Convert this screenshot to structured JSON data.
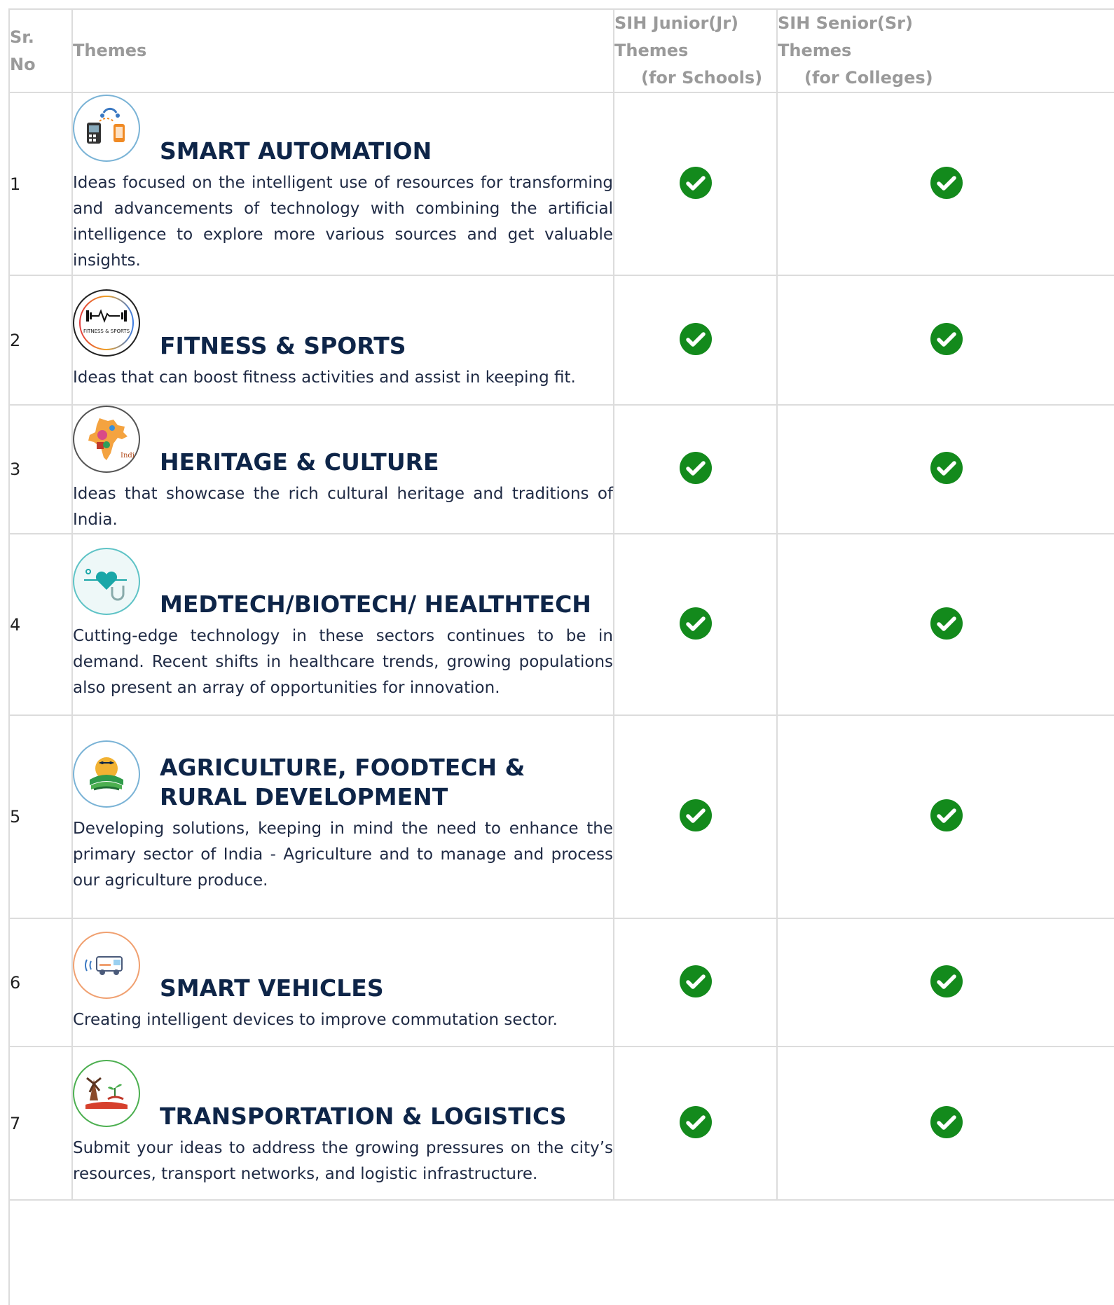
{
  "table": {
    "headers": {
      "sr": [
        "Sr.",
        "No"
      ],
      "themes": "Themes",
      "junior": [
        "SIH Junior(Jr)",
        "Themes",
        "(for Schools)"
      ],
      "senior": [
        "SIH Senior(Sr)",
        "Themes",
        "(for Colleges)"
      ]
    },
    "rows": [
      {
        "sr": "1",
        "title": "SMART AUTOMATION",
        "icon": "smart-automation-logo-icon",
        "desc": "Ideas focused on the intelligent use of resources for transforming and advancements of technology with combining the artificial intelligence to explore more various sources and get valuable insights.",
        "junior": true,
        "senior": true
      },
      {
        "sr": "2",
        "title": "FITNESS & SPORTS",
        "icon": "fitness-sports-logo-icon",
        "logo_text": "FITNESS & SPORTS",
        "desc": "Ideas that can boost fitness activities and assist in keeping fit.",
        "junior": true,
        "senior": true
      },
      {
        "sr": "3",
        "title": "HERITAGE & CULTURE",
        "icon": "heritage-culture-logo-icon",
        "logo_text": "India",
        "desc": "Ideas that showcase the rich cultural heritage and traditions of India.",
        "junior": true,
        "senior": true
      },
      {
        "sr": "4",
        "title": "MEDTECH/BIOTECH/ HEALTHTECH",
        "icon": "medtech-logo-icon",
        "desc": "Cutting-edge technology in these sectors continues to be in demand. Recent shifts in healthcare trends, growing populations also present an array of opportunities for innovation.",
        "junior": true,
        "senior": true
      },
      {
        "sr": "5",
        "title": "AGRICULTURE, FOODTECH & RURAL DEVELOPMENT",
        "icon": "agriculture-logo-icon",
        "desc": "Developing solutions, keeping in mind the need to enhance the primary sector of India - Agriculture and to manage and process our agriculture produce.",
        "junior": true,
        "senior": true
      },
      {
        "sr": "6",
        "title": "SMART VEHICLES",
        "icon": "smart-vehicles-logo-icon",
        "desc": "Creating intelligent devices to improve commutation sector.",
        "junior": true,
        "senior": true
      },
      {
        "sr": "7",
        "title": "TRANSPORTATION & LOGISTICS",
        "icon": "transportation-logo-icon",
        "desc": "Submit your ideas to address the growing pressures on the city’s resources, transport networks, and logistic infrastructure.",
        "junior": true,
        "senior": true
      }
    ]
  },
  "colors": {
    "check": "#138a1c",
    "title": "#0e2548",
    "header": "#9a9a9a",
    "border": "#dcdcdc"
  }
}
